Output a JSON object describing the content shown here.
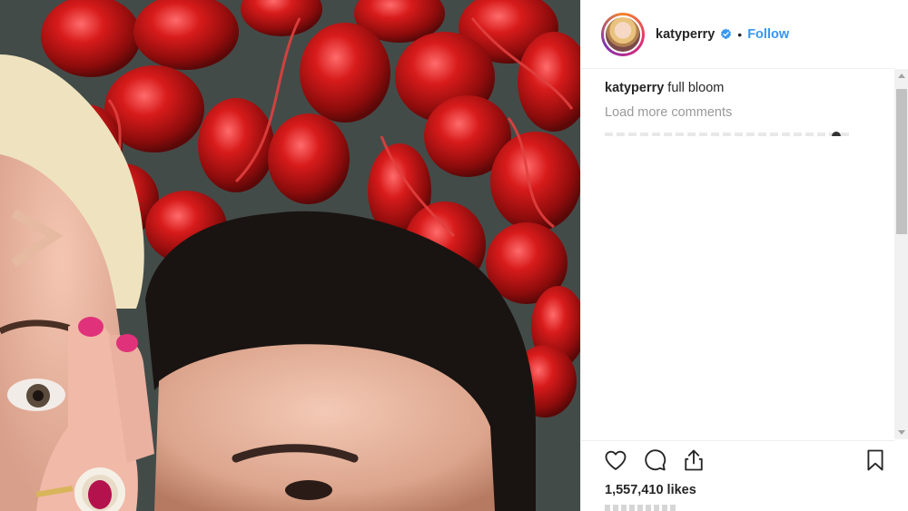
{
  "post": {
    "username": "katyperry",
    "separator": "•",
    "follow_label": "Follow",
    "caption_user": "katyperry",
    "caption_text": "full bloom",
    "load_more": "Load more comments",
    "likes": "1,557,410 likes"
  },
  "icons": {
    "verified": "verified-badge-icon",
    "like": "heart-icon",
    "comment": "comment-icon",
    "share": "share-icon",
    "save": "bookmark-icon"
  },
  "colors": {
    "link": "#3897f0",
    "verified": "#3897f0",
    "text": "#262626",
    "muted": "#999999"
  }
}
